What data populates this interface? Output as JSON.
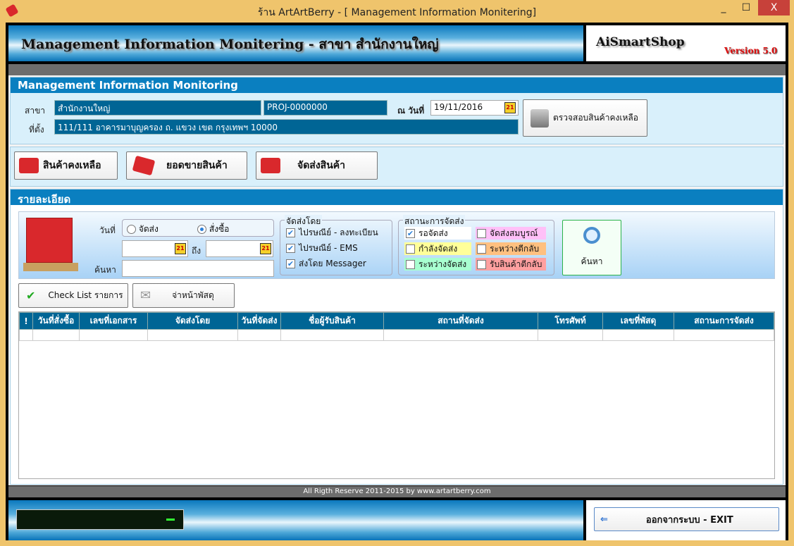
{
  "window": {
    "title": "ร้าน ArtArtBerry - [  Management Information Monitering]",
    "minimize": "_",
    "maximize": "☐",
    "close": "X"
  },
  "header": {
    "title": "Management Information Monitering - สาขา สำนักงานใหญ่",
    "brand": "AiSmartShop",
    "version": "Version 5.0"
  },
  "info": {
    "heading": "Management Information Monitoring",
    "branch_label": "สาขา",
    "branch_value": "สำนักงานใหญ่",
    "project_value": "PROJ-0000000",
    "date_label": "ณ วันที่",
    "date_value": "19/11/2016",
    "location_label": "ที่ตั้ง",
    "location_value": "111/111 อาคารมาบุญครอง ถ. แขวง เขต กรุงเทพฯ 10000",
    "check_stock_button": "ตรวจสอบสินค้าคงเหลือ"
  },
  "nav": {
    "stock": "สินค้าคงเหลือ",
    "sales": "ยอดขายสินค้า",
    "shipping": "จัดส่งสินค้า"
  },
  "details": {
    "heading": "รายละเอียด",
    "date_label": "วันที่",
    "radio_ship": "จัดส่ง",
    "radio_order": "สั่งซื้อ",
    "to_label": "ถึง",
    "search_label": "ค้นหา",
    "date_from": "",
    "date_to": "",
    "search_value": "",
    "ship_by": {
      "caption": "จัดส่งโดย",
      "options": [
        {
          "label": "ไปรษณีย์ - ลงทะเบียน",
          "checked": true
        },
        {
          "label": "ไปรษณีย์ - EMS",
          "checked": true
        },
        {
          "label": "ส่งโดย Messager",
          "checked": true
        }
      ]
    },
    "status": {
      "caption": "สถานะการจัดส่ง",
      "options": [
        {
          "label": "รอจัดส่ง",
          "checked": true,
          "color": "#ffffff"
        },
        {
          "label": "จัดส่งสมบูรณ์",
          "checked": false,
          "color": "#ffc0f8"
        },
        {
          "label": "กำลังจัดส่ง",
          "checked": false,
          "color": "#ffff99"
        },
        {
          "label": "ระหว่างตีกลับ",
          "checked": false,
          "color": "#ffc080"
        },
        {
          "label": "ระหว่างจัดส่ง",
          "checked": false,
          "color": "#a8ffd0"
        },
        {
          "label": "รับสินค้าตีกลับ",
          "checked": false,
          "color": "#ffa0a0"
        }
      ]
    },
    "search_button": "ค้นหา",
    "checklist_button": "Check List รายการ",
    "label_button": "จ่าหน้าพัสดุ"
  },
  "table": {
    "columns": [
      "!",
      "วันที่สั่งซื้อ",
      "เลขที่เอกสาร",
      "จัดส่งโดย",
      "วันที่จัดส่ง",
      "ชื่อผู้รับสินค้า",
      "สถานที่จัดส่ง",
      "โทรศัพท์",
      "เลขที่พัสดุ",
      "สถานะการจัดส่ง"
    ]
  },
  "footer": {
    "copyright": "All Rigth Reserve 2011-2015 by www.artartberry.com",
    "exit_button": "ออกจากระบบ - EXIT"
  },
  "colors": {
    "accent": "#0a7fc0",
    "field": "#006595",
    "title_bar": "#efc46c"
  }
}
